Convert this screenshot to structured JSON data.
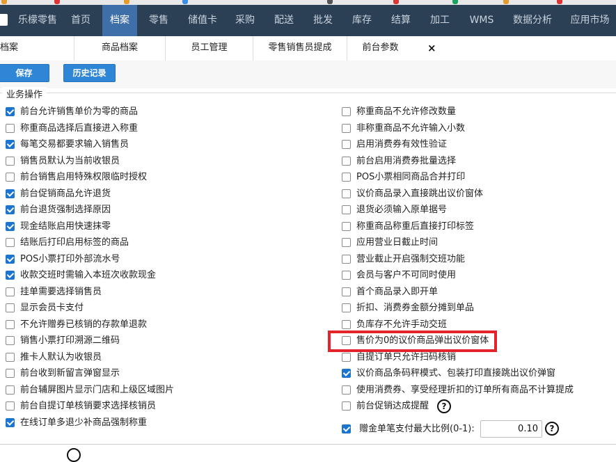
{
  "nav": {
    "items": [
      {
        "label": "乐檬零售"
      },
      {
        "label": "首页"
      },
      {
        "label": "档案"
      },
      {
        "label": "零售"
      },
      {
        "label": "储值卡"
      },
      {
        "label": "采购"
      },
      {
        "label": "配送"
      },
      {
        "label": "批发"
      },
      {
        "label": "库存"
      },
      {
        "label": "结算"
      },
      {
        "label": "加工"
      },
      {
        "label": "WMS"
      },
      {
        "label": "数据分析"
      },
      {
        "label": "应用市场"
      }
    ],
    "active_index": 2
  },
  "tabs": {
    "items": [
      {
        "label": "档案"
      },
      {
        "label": "商品档案"
      },
      {
        "label": "员工管理"
      },
      {
        "label": "零售销售员提成"
      },
      {
        "label": "前台参数"
      }
    ],
    "active_index": 4,
    "close_label": "×"
  },
  "toolbar": {
    "save_label": "保存",
    "history_label": "历史记录"
  },
  "section": {
    "title": "业务操作"
  },
  "options_left": [
    {
      "label": "前台允许销售单价为零的商品",
      "checked": true
    },
    {
      "label": "称重商品选择后直接进入称重",
      "checked": false
    },
    {
      "label": "每笔交易都要求输入销售员",
      "checked": true
    },
    {
      "label": "销售员默认为当前收银员",
      "checked": false
    },
    {
      "label": "前台销售启用特殊权限临时授权",
      "checked": false
    },
    {
      "label": "前台促销商品允许退货",
      "checked": true
    },
    {
      "label": "前台退货强制选择原因",
      "checked": true
    },
    {
      "label": "现金结账启用快速抹零",
      "checked": true
    },
    {
      "label": "结账后打印启用标签的商品",
      "checked": false
    },
    {
      "label": "POS小票打印外部流水号",
      "checked": true
    },
    {
      "label": "收款交班时需输入本班次收款现金",
      "checked": true
    },
    {
      "label": "挂单需要选择销售员",
      "checked": false
    },
    {
      "label": "显示会员卡支付",
      "checked": false
    },
    {
      "label": "不允许赠券已核销的存款单退款",
      "checked": false
    },
    {
      "label": "销售小票打印溯源二维码",
      "checked": false
    },
    {
      "label": "推卡人默认为收银员",
      "checked": false
    },
    {
      "label": "前台收到新留言弹窗显示",
      "checked": false
    },
    {
      "label": "前台辅屏图片显示门店和上级区域图片",
      "checked": false
    },
    {
      "label": "前台自提订单核销要求选择核销员",
      "checked": false
    },
    {
      "label": "在线订单多退少补商品强制称重",
      "checked": true
    }
  ],
  "options_right": [
    {
      "label": "称重商品不允许修改数量",
      "checked": false
    },
    {
      "label": "非称重商品不允许输入小数",
      "checked": false
    },
    {
      "label": "启用消费券有效性验证",
      "checked": false
    },
    {
      "label": "前台启用消费券批量选择",
      "checked": false
    },
    {
      "label": "POS小票相同商品合并打印",
      "checked": false
    },
    {
      "label": "议价商品录入直接跳出议价窗体",
      "checked": false
    },
    {
      "label": "退货必须输入原单据号",
      "checked": false
    },
    {
      "label": "称重商品称重后直接打印标签",
      "checked": false
    },
    {
      "label": "应用营业日截止时间",
      "checked": false
    },
    {
      "label": "营业截止开启强制交班功能",
      "checked": false
    },
    {
      "label": "会员与客户不可同时使用",
      "checked": false
    },
    {
      "label": "首个商品录入即开单",
      "checked": false
    },
    {
      "label": "折扣、消费券金额分摊到单品",
      "checked": false
    },
    {
      "label": "负库存不允许手动交班",
      "checked": false
    },
    {
      "label": "售价为0的议价商品弹出议价窗体",
      "checked": false
    },
    {
      "label": "自提订单只允许扫码核销",
      "checked": false
    },
    {
      "label": "议价商品条码秤模式、包装打印直接跳出议价弹窗",
      "checked": true
    },
    {
      "label": "使用消费券、享受经理折扣的订单所有商品不计算提成",
      "checked": false
    },
    {
      "label": "前台促销达成提醒",
      "checked": false
    }
  ],
  "gift_ratio": {
    "label": "赠金单笔支付最大比例(0-1):",
    "checked": true,
    "value": "0.10"
  },
  "help_glyph": "?",
  "colors": {
    "nav_bg": "#2b3f55",
    "nav_active": "#3f6fa8",
    "button_bg": "#2f86d6",
    "checkbox_on": "#1b75d0",
    "highlight_border": "#e3242b"
  }
}
